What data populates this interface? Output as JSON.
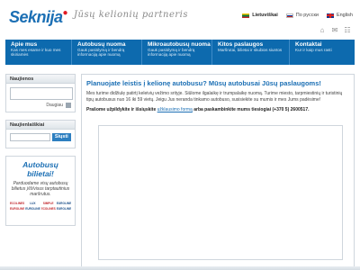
{
  "header": {
    "logo": "Seknija",
    "slogan": "Jūsų kelionių partneris",
    "languages": [
      {
        "label": "Lietuviškai",
        "active": true
      },
      {
        "label": "По русски",
        "active": false
      },
      {
        "label": "English",
        "active": false
      }
    ],
    "utility_icons": [
      "home-icon",
      "mail-icon",
      "sitemap-icon"
    ]
  },
  "nav": [
    {
      "title": "Apie mus",
      "sub": "Kas mes esame ir kuo mes skiriamės"
    },
    {
      "title": "Autobusų nuoma",
      "sub": "Gauk pasiūlymą ir bendrą informaciją apie nuomą"
    },
    {
      "title": "Mikroautobusų nuoma",
      "sub": "Gauk pasiūlymą ir bendrą informaciją apie nuomą"
    },
    {
      "title": "Kitos paslaugos",
      "sub": "Maršrutai, bilietai ir skubios siuntos"
    },
    {
      "title": "Kontaktai",
      "sub": "Kur ir kaip mus rasti"
    }
  ],
  "sidebar": {
    "search": {
      "title": "Naujienos",
      "button": "Daugiau"
    },
    "subscribe": {
      "title": "Naujienlaiškiai",
      "button": "Siųsti"
    },
    "ad": {
      "title": "Autobusų bilietai!",
      "text": "Parduodame visų autobusų bilietus į/iš/visus tarptautinius maršrutus.",
      "logos": [
        "ECOLINES",
        "LUX",
        "SIMPLE",
        "EUROLINES",
        "EUROLINES",
        "EUROLINES",
        "ECOLINES",
        "EUROLINES"
      ]
    }
  },
  "main": {
    "heading": "Planuojate leistis į kelionę autobusu? Mūsų autobusai Jūsų paslaugoms!",
    "intro": "Mes turime didžiulę patirtį keleivių vežimo srityje. Siūlome ilgalaikę ir trumpalaikę nuomą. Turime miesto, tarpmiestinių ir turistinių tipų autobusus nuo 16 iki 59 vietų. Jeigu Jus neranda tinkamo autobuso, susisiekite su mumis ir mes Jums padėsime!",
    "request_prefix": "Prašome užpildykite ir išsiųskite",
    "request_link": "užklausimo formą",
    "request_suffix": "arba paskambinkite mums tiesiogiai (+370 5) 2600517."
  }
}
